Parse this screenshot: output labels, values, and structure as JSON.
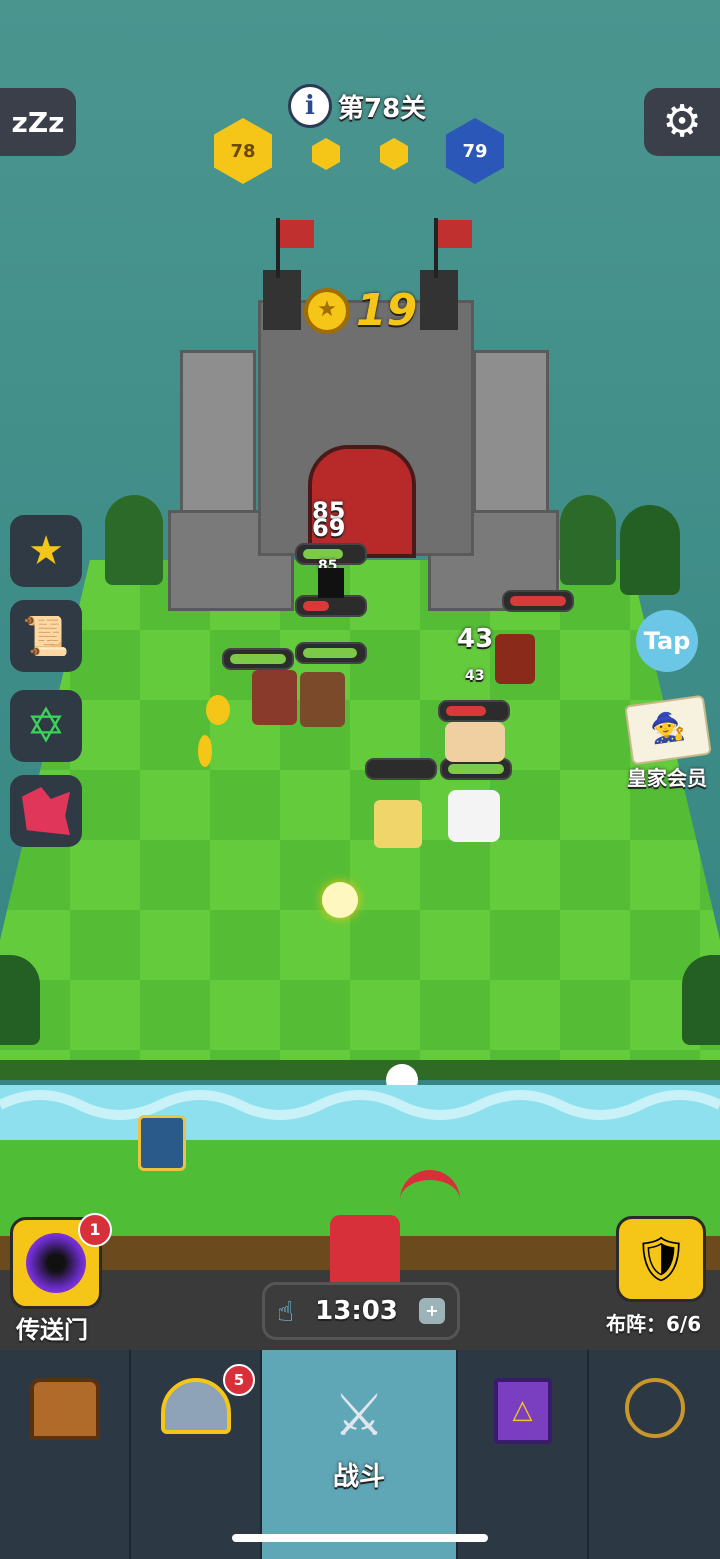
{
  "hud": {
    "level_label": "第78关",
    "current_level": "78",
    "next_level": "79",
    "coin_count": "19"
  },
  "battle": {
    "damage_numbers": [
      "85",
      "69",
      "85",
      "43",
      "43"
    ]
  },
  "side": {
    "tap_label": "Tap",
    "vip_label": "皇家会员"
  },
  "bottom": {
    "portal_label": "传送门",
    "portal_badge": "1",
    "timer": "13:03",
    "formation_label": "布阵：",
    "formation_value": "6/6"
  },
  "tabs": [
    {
      "name": "chest",
      "label": "",
      "badge": ""
    },
    {
      "name": "heroes",
      "label": "",
      "badge": "5"
    },
    {
      "name": "battle",
      "label": "战斗",
      "badge": ""
    },
    {
      "name": "spellbook",
      "label": "",
      "badge": ""
    },
    {
      "name": "equipment",
      "label": "",
      "badge": ""
    }
  ],
  "colors": {
    "gold": "#f5c518",
    "blue_hex": "#2b58b8",
    "tab_active": "#5fa6b6",
    "grass_light": "#67cd3f",
    "grass_dark": "#4fb534"
  }
}
